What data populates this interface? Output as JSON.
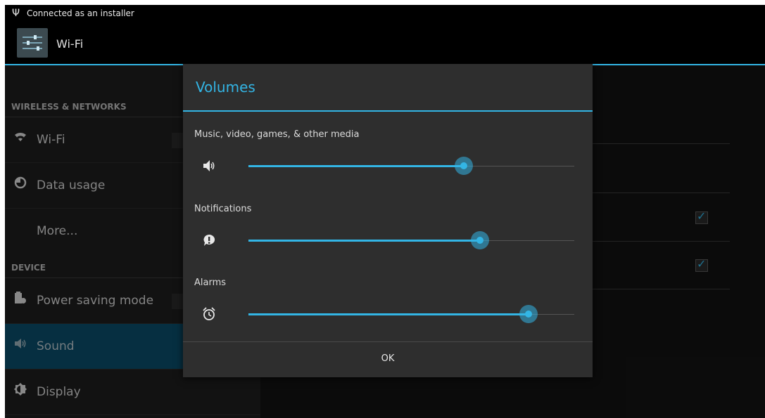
{
  "status_bar": {
    "notification": "Connected as an installer",
    "icon": "usb-icon"
  },
  "action_bar": {
    "title": "Wi-Fi",
    "icon": "settings-sliders-icon"
  },
  "settings_list": {
    "categories": [
      "WIRELESS & NETWORKS",
      "DEVICE"
    ],
    "items": [
      {
        "label": "Wi-Fi",
        "icon": "wifi-icon"
      },
      {
        "label": "Data usage",
        "icon": "data-usage-icon"
      },
      {
        "label": "More...",
        "icon": ""
      },
      {
        "label": "Power saving mode",
        "icon": "battery-icon"
      },
      {
        "label": "Sound",
        "icon": "speaker-icon",
        "selected": true
      },
      {
        "label": "Display",
        "icon": "brightness-icon"
      }
    ]
  },
  "right_pane": {
    "checkboxes": [
      true,
      true
    ]
  },
  "volumes_dialog": {
    "title": "Volumes",
    "sliders": [
      {
        "label": "Music, video, games, & other media",
        "icon": "speaker-icon",
        "level": 66
      },
      {
        "label": "Notifications",
        "icon": "notification-icon",
        "level": 71
      },
      {
        "label": "Alarms",
        "icon": "alarm-clock-icon",
        "level": 86
      }
    ],
    "ok_label": "OK"
  },
  "colors": {
    "accent": "#33b5e5",
    "selected_item_bg": "#0b4d6a",
    "dialog_bg": "#2e2e2e"
  }
}
